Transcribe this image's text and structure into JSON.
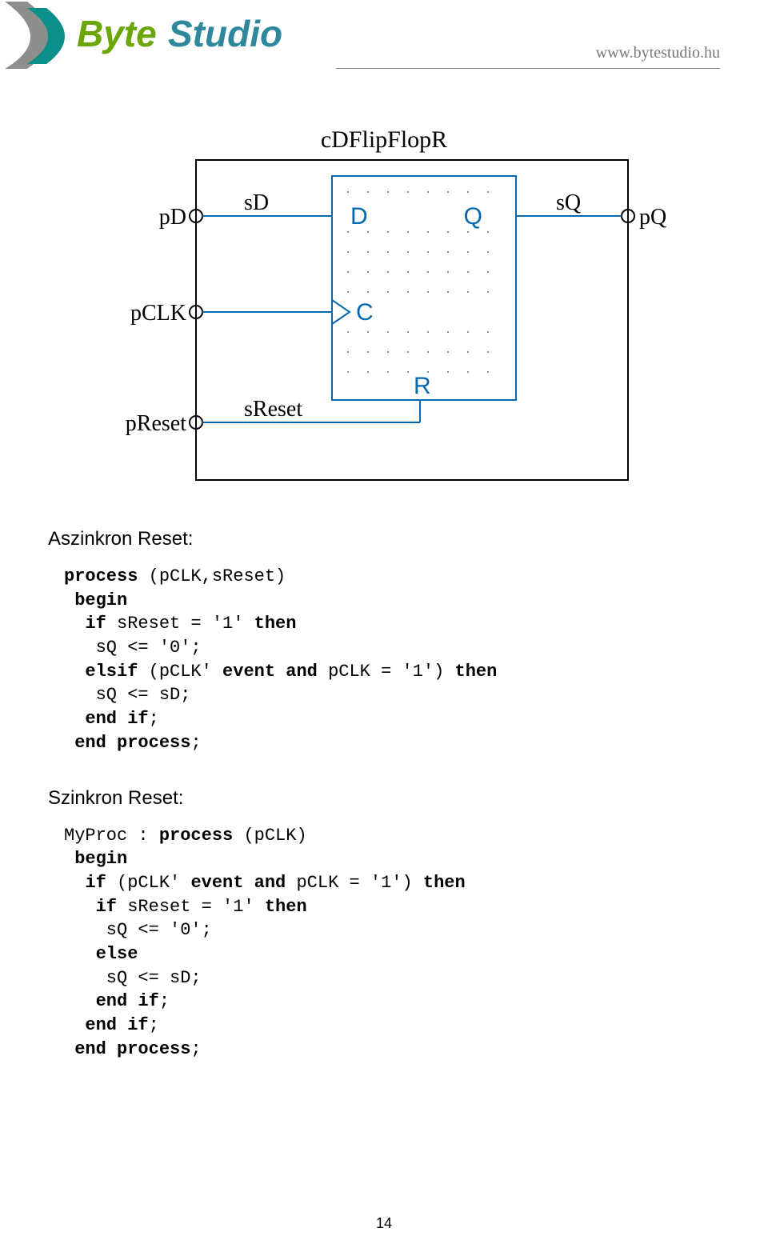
{
  "header": {
    "logo_text_byte": "Byte",
    "logo_text_studio": "Studio",
    "site_url": "www.bytestudio.hu"
  },
  "diagram": {
    "title": "cDFlipFlopR",
    "ports_left": [
      "pD",
      "pCLK",
      "pReset"
    ],
    "ports_right": [
      "pQ"
    ],
    "signals": {
      "sD": "sD",
      "sQ": "sQ",
      "sReset": "sReset"
    },
    "inner_labels": {
      "D": "D",
      "C": "C",
      "R": "R",
      "Q": "Q"
    }
  },
  "sections": {
    "async": {
      "title": "Aszinkron Reset:",
      "code_plain": "process (pCLK,sReset)\n begin\n  if sReset = '1' then\n   sQ <= '0';\n  elsif (pCLK' event and pCLK = '1') then\n   sQ <= sD;\n  end if;\n end process;"
    },
    "sync": {
      "title": "Szinkron Reset:",
      "code_plain": "MyProc : process (pCLK)\n begin\n  if (pCLK' event and pCLK = '1') then\n   if sReset = '1' then\n    sQ <= '0';\n   else\n    sQ <= sD;\n   end if;\n  end if;\n end process;"
    }
  },
  "page_number": "14"
}
